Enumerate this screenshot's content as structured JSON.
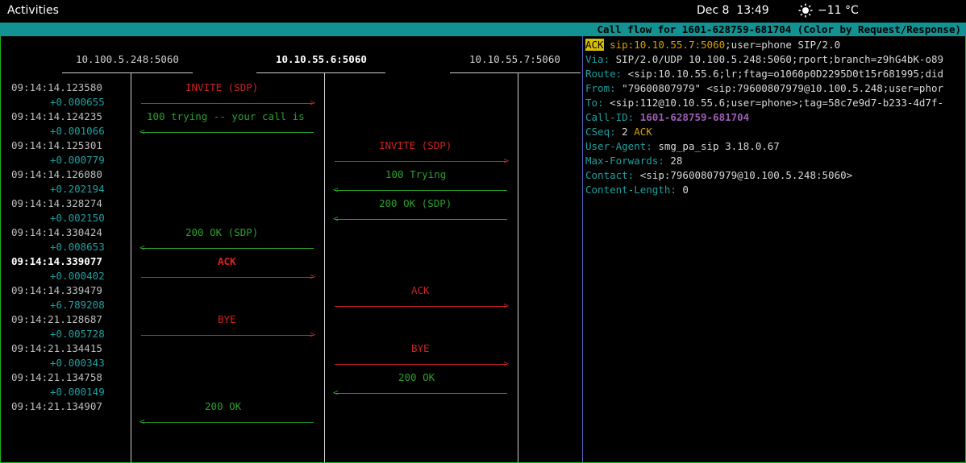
{
  "topbar": {
    "activities": "Activities",
    "date": "Dec 8",
    "time": "13:49",
    "weather": "−11 °C"
  },
  "title": "Call flow for 1601-628759-681704 (Color by Request/Response)",
  "hosts": [
    "10.100.5.248:5060",
    "10.10.55.6:5060",
    "10.10.55.7:5060"
  ],
  "timestamps": [
    "09:14:14.123580",
    "+0.000655",
    "09:14:14.124235",
    "+0.001066",
    "09:14:14.125301",
    "+0.000779",
    "09:14:14.126080",
    "+0.202194",
    "09:14:14.328274",
    "+0.002150",
    "09:14:14.330424",
    "+0.008653",
    "09:14:14.339077",
    "+0.000402",
    "09:14:14.339479",
    "+6.789208",
    "09:14:21.128687",
    "+0.005728",
    "09:14:21.134415",
    "+0.000343",
    "09:14:21.134758",
    "+0.000149",
    "09:14:21.134907"
  ],
  "messages": [
    {
      "label": "INVITE (SDP)",
      "color": "#cc2222"
    },
    {
      "label": "100 trying -- your call is",
      "color": "#2ca02c"
    },
    {
      "label": "INVITE (SDP)",
      "color": "#cc2222"
    },
    {
      "label": "100 Trying",
      "color": "#2ca02c"
    },
    {
      "label": "200 OK (SDP)",
      "color": "#2ca02c"
    },
    {
      "label": "200 OK (SDP)",
      "color": "#2ca02c"
    },
    {
      "label": "ACK",
      "color": "#e02222"
    },
    {
      "label": "ACK",
      "color": "#cc2222"
    },
    {
      "label": "BYE",
      "color": "#cc2222"
    },
    {
      "label": "BYE",
      "color": "#cc2222"
    },
    {
      "label": "200 OK",
      "color": "#2ca02c"
    },
    {
      "label": "200 OK",
      "color": "#2ca02c"
    }
  ],
  "raw": {
    "request_method": "ACK",
    "request_uri": "sip:10.10.55.7:5060",
    "request_rest": ";user=phone SIP/2.0",
    "headers": [
      {
        "name": "Via:",
        "value": " SIP/2.0/UDP 10.100.5.248:5060;rport;branch=z9hG4bK-o89"
      },
      {
        "name": "Route:",
        "value": " <sip:10.10.55.6;lr;ftag=o1060p0D2295D0t15r681995;did"
      },
      {
        "name": "From:",
        "value": " \"79600807979\" <sip:79600807979@10.100.5.248;user=phor"
      },
      {
        "name": "To:",
        "value": " <sip:112@10.10.55.6;user=phone>;tag=58c7e9d7-b233-4d7f-"
      },
      {
        "name": "Call-ID:",
        "value": "1601-628759-681704"
      },
      {
        "name": "CSeq:",
        "value": " 2 ",
        "method": "ACK"
      },
      {
        "name": "User-Agent:",
        "value": " smg_pa_sip 3.18.0.67"
      },
      {
        "name": "Max-Forwards:",
        "value": " 28"
      },
      {
        "name": "Contact:",
        "value": " <sip:79600807979@10.100.5.248:5060>"
      },
      {
        "name": "Content-Length:",
        "value": " 0"
      }
    ]
  },
  "colors": {
    "title_bg": "#129292",
    "request": "#cc2222",
    "response": "#2ca02c",
    "delta": "#1fa0a0",
    "border": "#1fb41f"
  },
  "icons": {
    "weather": "sun-icon"
  }
}
